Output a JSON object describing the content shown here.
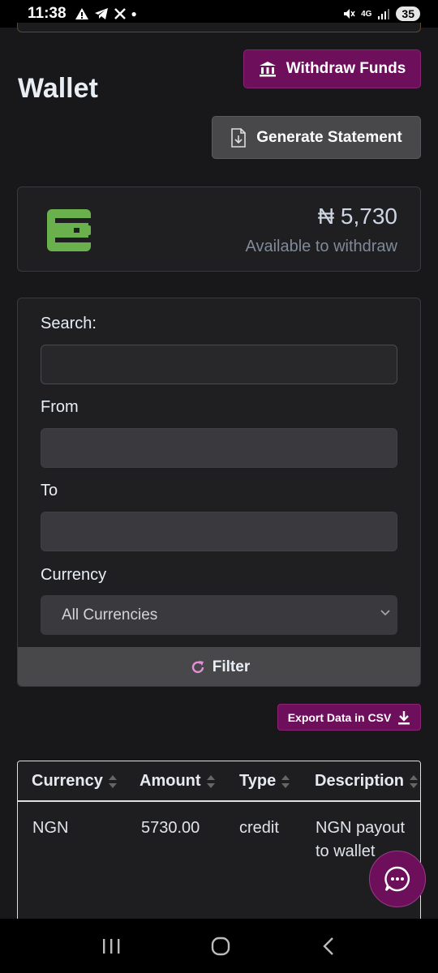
{
  "status_bar": {
    "time": "11:38",
    "notification_icons": [
      "warning-icon",
      "telegram-icon",
      "x-icon",
      "dot"
    ],
    "network": "4G",
    "battery": "35"
  },
  "header": {
    "title": "Wallet",
    "withdraw_label": "Withdraw Funds",
    "statement_label": "Generate Statement"
  },
  "balance": {
    "amount": "₦ 5,730",
    "subtitle": "Available to withdraw"
  },
  "filters": {
    "search_label": "Search:",
    "search_value": "",
    "from_label": "From",
    "from_value": "",
    "to_label": "To",
    "to_value": "",
    "currency_label": "Currency",
    "currency_selected": "All Currencies",
    "filter_button": "Filter"
  },
  "export": {
    "label": "Export Data in CSV"
  },
  "table": {
    "columns": [
      "Currency",
      "Amount",
      "Type",
      "Description"
    ],
    "rows": [
      {
        "currency": "NGN",
        "amount": "5730.00",
        "type": "credit",
        "description_line1": "NGN payout",
        "description_line2": "to wallet"
      }
    ]
  },
  "colors": {
    "accent": "#6e0f5c",
    "background": "#18181b",
    "wallet_icon": "#6ab04c"
  }
}
